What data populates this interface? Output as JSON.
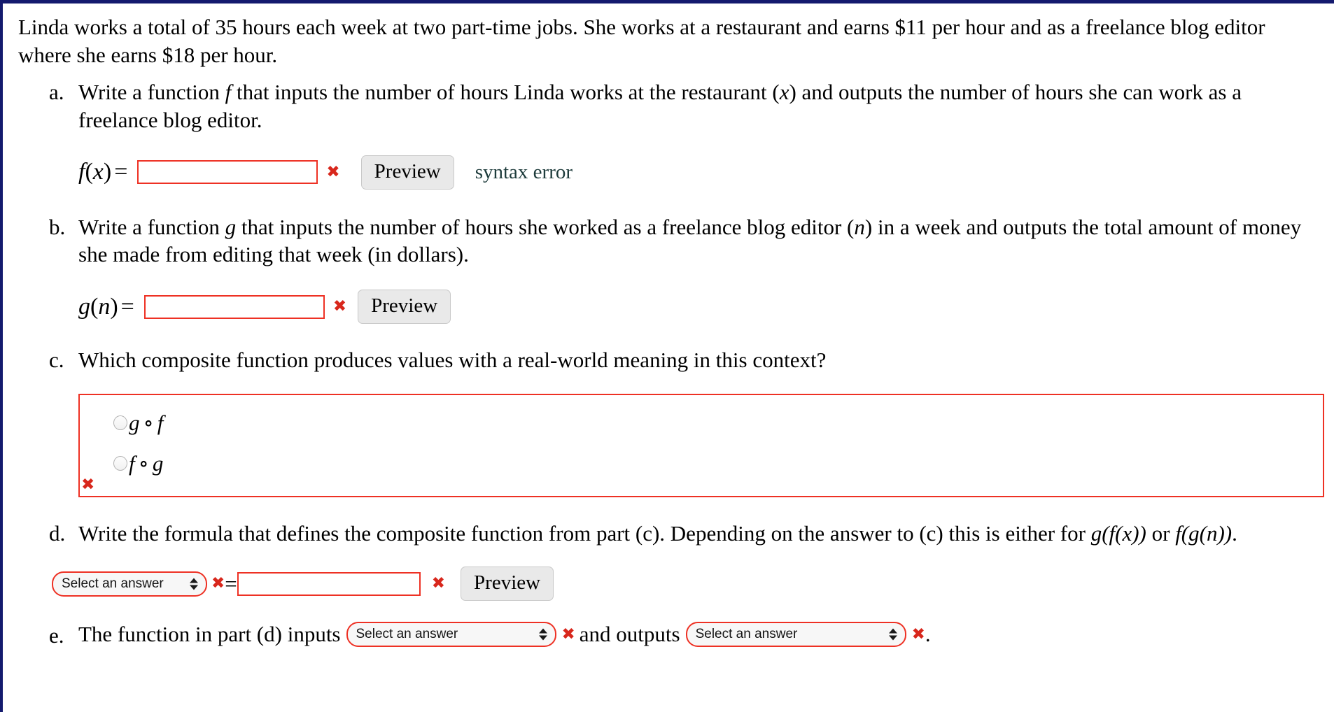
{
  "problem": {
    "intro": "Linda works a total of 35 hours each week at two part-time jobs. She works at a restaurant and earns $11 per hour and as a freelance blog editor where she earns $18 per hour."
  },
  "parts": {
    "a": {
      "marker": "a.",
      "text_1": "Write a function",
      "var": "f",
      "text_2": "that inputs the number of hours Linda works at the restaurant (",
      "var2": "x",
      "text_3": ") and outputs the number of hours she can work as a freelance blog editor.",
      "label_fn": "f",
      "label_open": "(",
      "label_arg": "x",
      "label_close": ")",
      "label_eq": "=",
      "input_value": "",
      "input_placeholder": "",
      "error_mark": "✖",
      "preview_label": "Preview",
      "status": "syntax error"
    },
    "b": {
      "marker": "b.",
      "text_1": "Write a function",
      "var": "g",
      "text_2": "that inputs the number of hours she worked as a freelance blog editor (",
      "var2": "n",
      "text_3": ") in a week and outputs the total amount of money she made from editing that week (in dollars).",
      "label_fn": "g",
      "label_open": "(",
      "label_arg": "n",
      "label_close": ")",
      "label_eq": "=",
      "input_value": "",
      "input_placeholder": "",
      "error_mark": "✖",
      "preview_label": "Preview"
    },
    "c": {
      "marker": "c.",
      "text": "Which composite function produces values with a real-world meaning in this context?",
      "options": [
        {
          "fn1": "g",
          "ring": "∘",
          "fn2": "f",
          "selected": false
        },
        {
          "fn1": "f",
          "ring": "∘",
          "fn2": "g",
          "selected": false
        }
      ],
      "error_mark": "✖"
    },
    "d": {
      "marker": "d.",
      "text_1": "Write the formula that defines the composite function from part (c). Depending on the answer to (c) this is either for",
      "expr_1": "g(f(x))",
      "text_2": "or",
      "expr_2": "f(g(n))",
      "text_3": ".",
      "select_value": "Select an answer",
      "error_mark_1": "✖",
      "equals": "=",
      "input_value": "",
      "input_placeholder": "",
      "error_mark_2": "✖",
      "preview_label": "Preview"
    },
    "e": {
      "marker": "e.",
      "text_1": "The function in part (d) inputs",
      "select_1_value": "Select an answer",
      "error_mark_1": "✖",
      "text_2": "and outputs",
      "select_2_value": "Select an answer",
      "error_mark_2": "✖",
      "text_3": "."
    }
  },
  "colors": {
    "page_border": "#141a6e",
    "error_red": "#ee3124",
    "x_mark": "#d8271c",
    "status_text": "#1d3b3b",
    "button_face": "#e9e9e9"
  }
}
